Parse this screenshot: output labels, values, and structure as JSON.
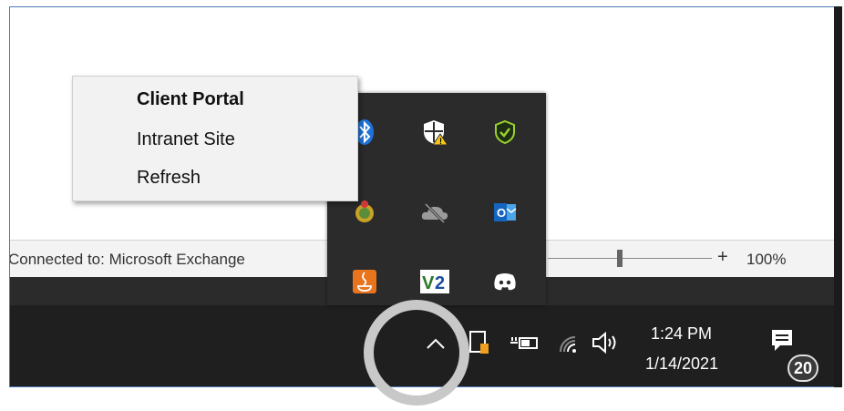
{
  "context_menu": {
    "items": [
      {
        "label": "Client Portal",
        "default": true
      },
      {
        "label": "Intranet Site",
        "default": false
      },
      {
        "label": "Refresh",
        "default": false
      }
    ]
  },
  "status_bar": {
    "connection_text": "Connected to: Microsoft Exchange",
    "zoom_plus": "+",
    "zoom_level": "100%"
  },
  "tray_flyout": {
    "icons": [
      "bluetooth-icon",
      "windows-security-icon",
      "antivirus-shield-icon",
      "app-tray-icon",
      "onedrive-offline-icon",
      "outlook-icon",
      "java-icon",
      "vnc-viewer-icon",
      "discord-icon"
    ],
    "vnc_label": "V2",
    "outlook_label": "O"
  },
  "taskbar": {
    "chevron": "^",
    "time": "1:24 PM",
    "date": "1/14/2021",
    "notification_count": "20"
  },
  "colors": {
    "taskbar": "#1f1f1f",
    "flyout": "#2b2b2b",
    "menu": "#f2f2f2",
    "frame_border": "#4a7ab5",
    "highlight": "#c8c8c8"
  }
}
